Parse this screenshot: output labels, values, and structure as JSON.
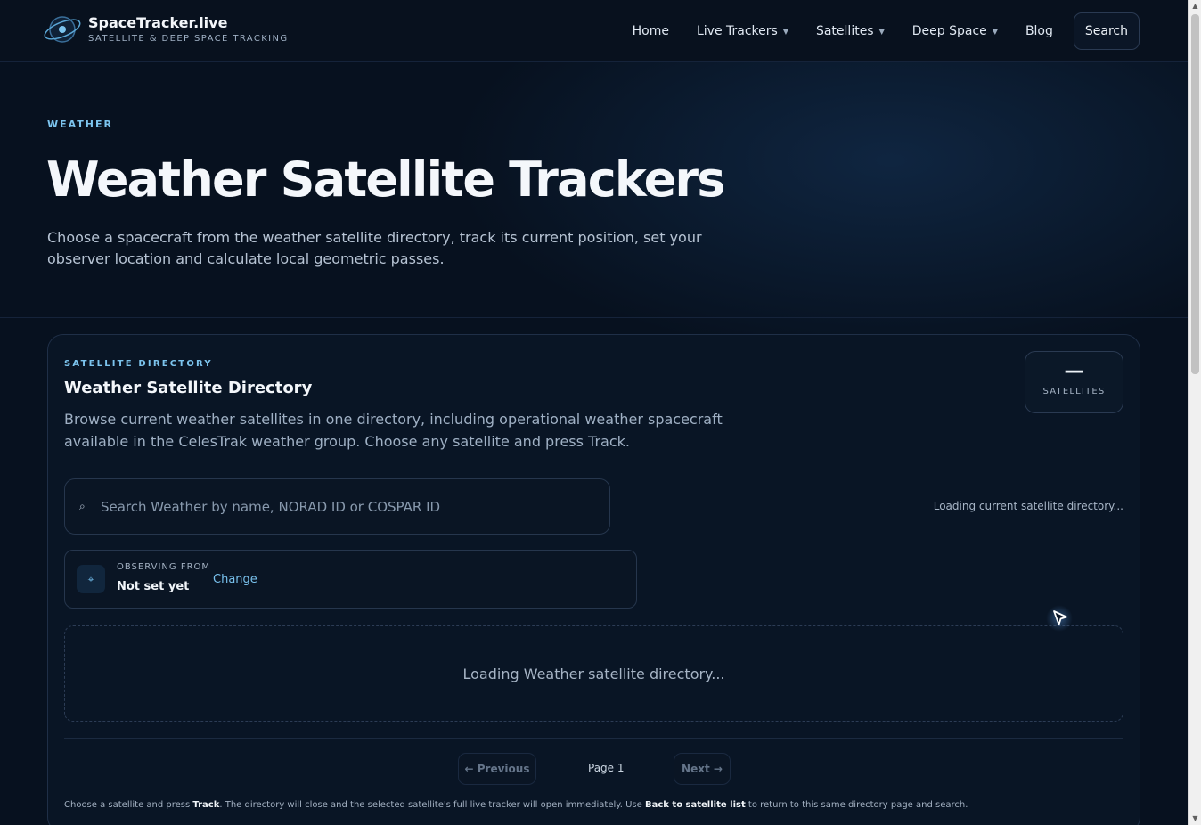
{
  "header": {
    "brand_title": "SpaceTracker.live",
    "brand_subtitle": "SATELLITE & DEEP SPACE TRACKING",
    "nav": [
      {
        "label": "Home"
      },
      {
        "label": "Live Trackers",
        "dropdown": true
      },
      {
        "label": "Satellites",
        "dropdown": true
      },
      {
        "label": "Deep Space",
        "dropdown": true
      },
      {
        "label": "Blog"
      }
    ],
    "search_label": "Search"
  },
  "hero": {
    "kicker": "WEATHER",
    "title": "Weather Satellite Trackers",
    "description": "Choose a spacecraft from the weather satellite directory, track its current position, set your observer location and calculate local geometric passes."
  },
  "directory": {
    "kicker": "SATELLITE DIRECTORY",
    "title": "Weather Satellite Directory",
    "description": "Browse current weather satellites in one directory, including operational weather spacecraft available in the CelesTrak weather group. Choose any satellite and press Track.",
    "count_value": "—",
    "count_label": "SATELLITES",
    "search_placeholder": "Search Weather by name, NORAD ID or COSPAR ID",
    "loading_status": "Loading current satellite directory...",
    "observer_label": "OBSERVING FROM",
    "observer_value": "Not set yet",
    "observer_change": "Change",
    "list_loading": "Loading Weather satellite directory...",
    "prev_label": "← Previous",
    "page_label": "Page 1",
    "next_label": "Next →",
    "footnote": {
      "part1": "Choose a satellite and press ",
      "bold1": "Track",
      "part2": ". The directory will close and the selected satellite's full live tracker will open immediately. Use ",
      "bold2": "Back to satellite list",
      "part3": " to return to this same directory page and search."
    }
  },
  "colors": {
    "background": "#07111f",
    "accent": "#7cc4ee",
    "link": "#78c0ec"
  },
  "icons": {
    "logo": "orbit-planet-icon",
    "search": "search-icon",
    "observer": "crosshair-icon",
    "cursor": "mouse-pointer-icon"
  }
}
